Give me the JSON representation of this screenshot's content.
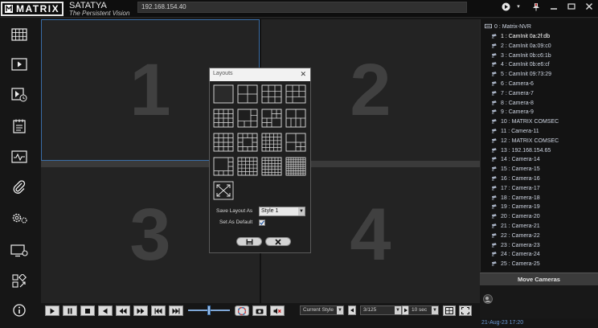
{
  "app": {
    "logo_text": "MATRIX",
    "brand": "SATATYA",
    "tagline": "The Persistent Vision",
    "address": "192.168.154.40",
    "accent_color": "#3a6ea8"
  },
  "titlebar_icons": [
    "play-circle-icon",
    "dropdown-icon",
    "pin-icon",
    "minimize-icon",
    "maximize-icon",
    "close-icon"
  ],
  "sidebar": [
    {
      "icon": "live-view-grid-icon"
    },
    {
      "icon": "playback-icon"
    },
    {
      "icon": "timeline-playback-icon"
    },
    {
      "icon": "event-log-icon"
    },
    {
      "icon": "system-health-icon"
    },
    {
      "icon": "attachment-icon"
    },
    {
      "icon": "settings-icon"
    },
    {
      "icon": "display-settings-icon"
    },
    {
      "icon": "tools-icon"
    },
    {
      "icon": "info-icon"
    }
  ],
  "grid": {
    "cells": [
      "1",
      "2",
      "3",
      "4"
    ]
  },
  "dialog": {
    "title": "Layouts",
    "save_label": "Save Layout As",
    "save_value": "Style 1",
    "default_label": "Set As Default",
    "default_checked": true
  },
  "devices": {
    "root": "0 : Matrix-NVR",
    "cameras": [
      "1 : CamInit 0a:2f:db",
      "2 : CamInit 0a:09:c0",
      "3 : CamInit 0b:c6:1b",
      "4 : CamInit 0b:e6:cf",
      "5 : CamInit 09:73:29",
      "6 : Camera-6",
      "7 : Camera-7",
      "8 : Camera-8",
      "9 : Camera-9",
      "10 : MATRIX COMSEC",
      "11 : Camera-11",
      "12 : MATRIX COMSEC",
      "13 : 192.168.154.65",
      "14 : Camera-14",
      "15 : Camera-15",
      "16 : Camera-16",
      "17 : Camera-17",
      "18 : Camera-18",
      "19 : Camera-19",
      "20 : Camera-20",
      "21 : Camera-21",
      "22 : Camera-22",
      "23 : Camera-23",
      "24 : Camera-24",
      "25 : Camera-25"
    ],
    "selected_index": 0
  },
  "move_cameras": "Move Cameras",
  "datetime": "21-Aug-23 17:20",
  "bottom": {
    "style_value": "Current Style",
    "page_value": "3/125",
    "interval_value": "10 sec"
  }
}
